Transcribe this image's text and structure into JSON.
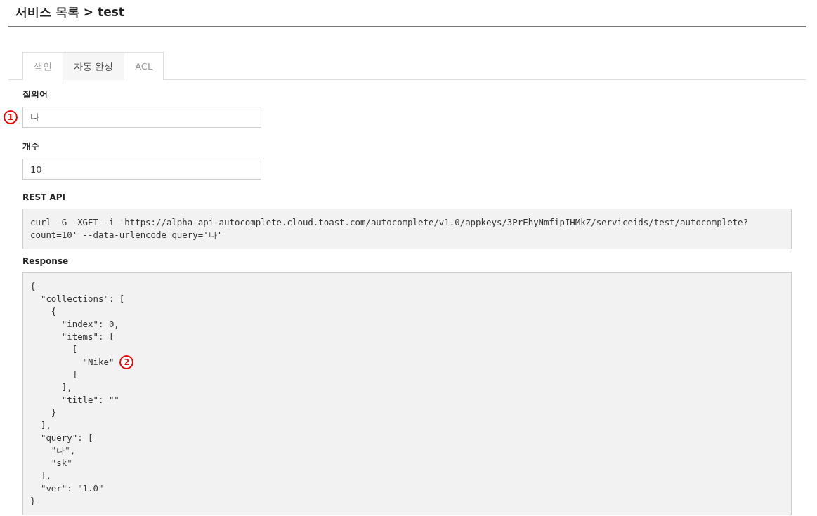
{
  "header": {
    "title": "서비스 목록 > test"
  },
  "tabs": [
    {
      "label": "색인",
      "selected": false
    },
    {
      "label": "자동 완성",
      "selected": true
    },
    {
      "label": "ACL",
      "selected": false
    }
  ],
  "fields": [
    {
      "label": "질의어",
      "value": "나",
      "callout": "1"
    },
    {
      "label": "개수",
      "value": "10"
    }
  ],
  "rest_api": {
    "label": "REST API",
    "lines": [
      "curl -G -XGET -i 'https://alpha-api-autocomplete.cloud.toast.com/autocomplete/v1.0/appkeys/3PrEhyNmfipIHMkZ/serviceids/test/autocomplete?",
      "count=10' --data-urlencode query='나'"
    ]
  },
  "response": {
    "label": "Response",
    "lines": [
      {
        "text": "{"
      },
      {
        "text": "  \"collections\": ["
      },
      {
        "text": "    {"
      },
      {
        "text": "      \"index\": 0,"
      },
      {
        "text": "      \"items\": ["
      },
      {
        "text": "        ["
      },
      {
        "text": "          \"Nike\"",
        "callout": "2"
      },
      {
        "text": "        ]"
      },
      {
        "text": "      ],"
      },
      {
        "text": "      \"title\": \"\""
      },
      {
        "text": "    }"
      },
      {
        "text": "  ],"
      },
      {
        "text": "  \"query\": ["
      },
      {
        "text": "    \"나\","
      },
      {
        "text": "    \"sk\""
      },
      {
        "text": "  ],"
      },
      {
        "text": "  \"ver\": \"1.0\""
      },
      {
        "text": "}"
      }
    ]
  }
}
